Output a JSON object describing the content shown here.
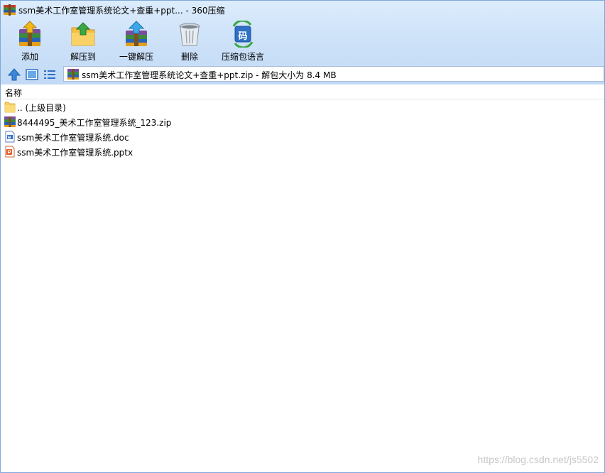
{
  "window": {
    "title": "ssm美术工作室管理系统论文+查重+ppt... - 360压缩"
  },
  "toolbar": {
    "add": "添加",
    "extract_to": "解压到",
    "one_click_extract": "一键解压",
    "delete": "删除",
    "archive_language": "压缩包语言",
    "language_badge": "码"
  },
  "address": {
    "path": "ssm美术工作室管理系统论文+查重+ppt.zip - 解包大小为 8.4 MB"
  },
  "file_list": {
    "column_name": "名称",
    "items": [
      {
        "name": ".. (上级目录)",
        "icon": "folder-icon"
      },
      {
        "name": "8444495_美术工作室管理系统_123.zip",
        "icon": "zip-archive-icon"
      },
      {
        "name": "ssm美术工作室管理系统.doc",
        "icon": "word-document-icon"
      },
      {
        "name": "ssm美术工作室管理系统.pptx",
        "icon": "powerpoint-file-icon"
      }
    ]
  },
  "watermark": "https://blog.csdn.net/js5502"
}
